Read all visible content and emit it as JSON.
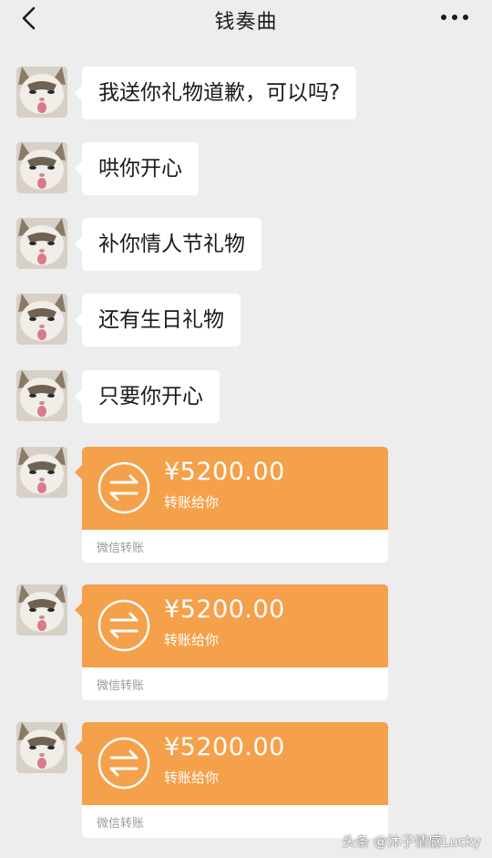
{
  "header": {
    "title": "钱奏曲",
    "back_icon": "chevron-left-icon",
    "more_icon": "more-dots-icon"
  },
  "messages": [
    {
      "text": "我送你礼物道歉，可以吗?"
    },
    {
      "text": "哄你开心"
    },
    {
      "text": "补你情人节礼物"
    },
    {
      "text": "还有生日礼物"
    },
    {
      "text": "只要你开心"
    }
  ],
  "transfers": [
    {
      "amount": "¥5200.00",
      "desc": "转账给你",
      "footer": "微信转账"
    },
    {
      "amount": "¥5200.00",
      "desc": "转账给你",
      "footer": "微信转账"
    },
    {
      "amount": "¥5200.00",
      "desc": "转账给你",
      "footer": "微信转账"
    }
  ],
  "watermark": "头条 @沐子情感Lucky",
  "colors": {
    "background": "#ededed",
    "bubble": "#ffffff",
    "transfer": "#f5a04a"
  }
}
